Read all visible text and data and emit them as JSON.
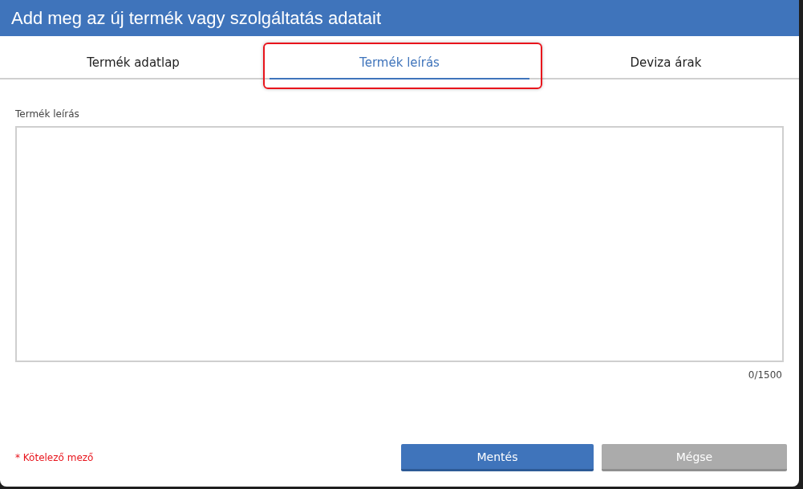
{
  "window": {
    "title": "Add meg az új termék vagy szolgáltatás adatait"
  },
  "tabs": [
    {
      "label": "Termék adatlap",
      "selected": false,
      "highlighted": false
    },
    {
      "label": "Termék leírás",
      "selected": true,
      "highlighted": true
    },
    {
      "label": "Deviza árak",
      "selected": false,
      "highlighted": false
    }
  ],
  "description": {
    "label": "Termék leírás",
    "counter": "0/1500"
  },
  "footer": {
    "required_note": "* Kötelező mező"
  },
  "buttons": [
    {
      "label": "Mentés",
      "kind": "primary"
    },
    {
      "label": "Mégse",
      "kind": "secondary"
    }
  ]
}
